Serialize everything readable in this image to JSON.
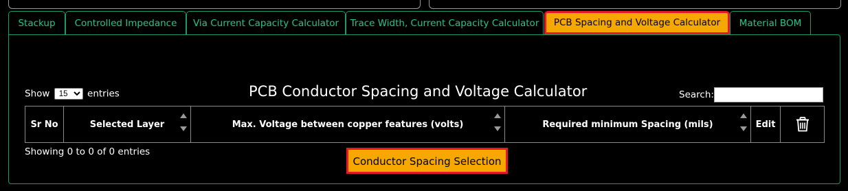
{
  "tabs": [
    {
      "label": "Stackup"
    },
    {
      "label": "Controlled Impedance"
    },
    {
      "label": "Via Current Capacity Calculator"
    },
    {
      "label": "Trace Width, Current Capacity Calculator"
    },
    {
      "label": "PCB Spacing and Voltage Calculator",
      "active": true
    },
    {
      "label": "Material BOM"
    }
  ],
  "table_controls": {
    "show_label": "Show",
    "entries_value": "15",
    "entries_label": "entries",
    "search_label": "Search:",
    "search_value": ""
  },
  "title": "PCB Conductor Spacing and Voltage Calculator",
  "table": {
    "columns": [
      "Sr No",
      "Selected Layer",
      "Max. Voltage between copper features (volts)",
      "Required minimum Spacing (mils)",
      "Edit"
    ],
    "delete_icon": "trash-icon",
    "rows": []
  },
  "info": "Showing 0 to 0 of 0 entries",
  "action_button": "Conductor Spacing Selection",
  "colors": {
    "tab_text": "#27c68a",
    "accent": "#f7a800",
    "highlight_border": "#e3182b"
  }
}
